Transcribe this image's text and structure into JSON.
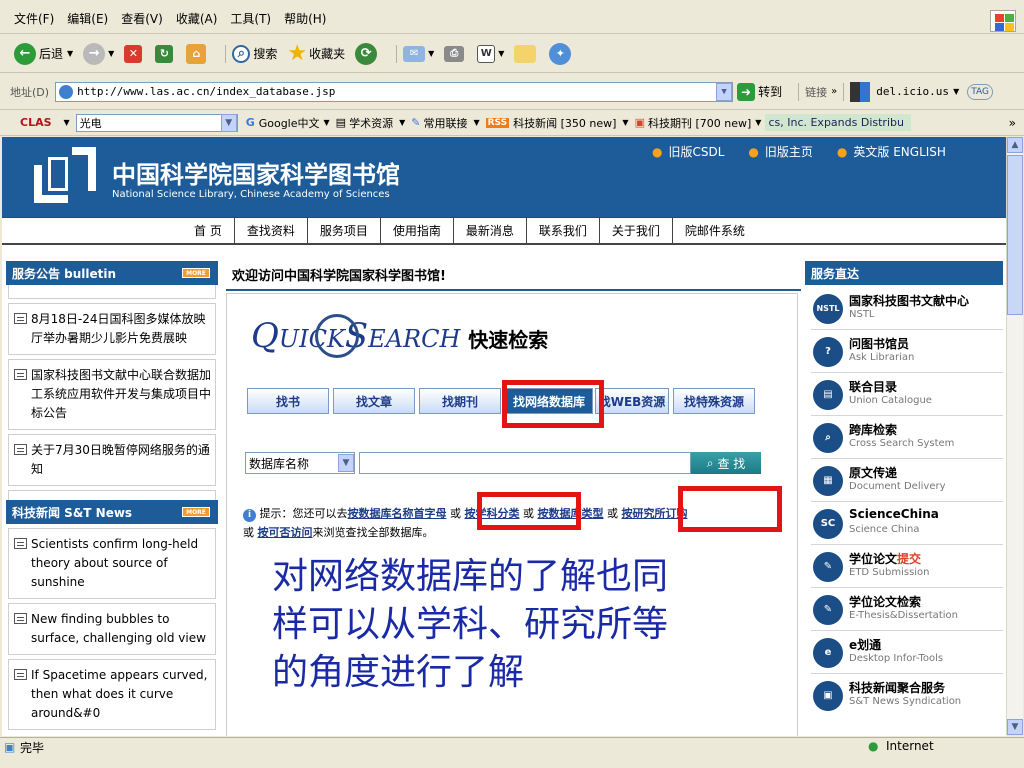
{
  "menu": {
    "items": [
      "文件(F)",
      "编辑(E)",
      "查看(V)",
      "收藏(A)",
      "工具(T)",
      "帮助(H)"
    ]
  },
  "toolbar": {
    "back": "后退",
    "search": "搜索",
    "favorites": "收藏夹"
  },
  "address": {
    "label": "地址(D)",
    "url": "http://www.las.ac.cn/index_database.jsp",
    "go": "转到",
    "links": "链接",
    "delicious": "del.icio.us",
    "tag": "TAG"
  },
  "linkbar": {
    "clas": "CLAS",
    "field": "光电",
    "items": [
      "Google中文",
      "学术资源",
      "常用联接",
      "科技新闻 [350 new]",
      "科技期刊 [700 new]"
    ],
    "rss": "RSS",
    "ticker": "cs, Inc. Expands Distribu"
  },
  "site": {
    "title_cn": "中国科学院国家科学图书馆",
    "title_en": "National Science Library, Chinese Academy of Sciences",
    "toplinks": [
      "旧版CSDL",
      "旧版主页",
      "英文版 ENGLISH"
    ],
    "nav": [
      "首 页",
      "查找资料",
      "服务项目",
      "使用指南",
      "最新消息",
      "联系我们",
      "关于我们",
      "院邮件系统"
    ]
  },
  "bulletin": {
    "heading": "服务公告 bulletin",
    "more": "MORE",
    "items": [
      "8月18日-24日国科图多媒体放映厅举办暑期少儿影片免费展映",
      "国家科技图书文献中心联合数据加工系统应用软件开发与集成项目中标公告",
      "关于7月30日晚暂停网络服务的通知"
    ]
  },
  "news": {
    "heading": "科技新闻 S&T News",
    "more": "MORE",
    "items": [
      "Scientists confirm long-held theory about source of sunshine",
      "New finding bubbles to surface, challenging old view",
      "If Spacetime appears curved, then what does it curve around&#0"
    ]
  },
  "main": {
    "welcome": "欢迎访问中国科学院国家科学图书馆!",
    "quick_a": "Q",
    "quick_b": "UICK",
    "quick_c": "S",
    "quick_d": "EARCH",
    "quick_cn": "快速检索",
    "tabs": [
      "找书",
      "找文章",
      "找期刊",
      "找网络数据库",
      "找WEB资源",
      "找特殊资源"
    ],
    "select_value": "数据库名称",
    "search_btn": "查 找",
    "hint_prefix": "提示：您还可以去",
    "hint_link1": "按数据库名称首字母",
    "or1": "或",
    "hint_link2": "按学科分类",
    "or2": "或",
    "hint_link3": "按数据库类型",
    "or3": "或",
    "hint_link4": "按研究所订购",
    "or4": "或",
    "hint_link5": "按可否访问",
    "hint_suffix": "来浏览查找全部数据库。",
    "annotation": [
      "对网络数据库的了解也同",
      "样可以从学科、研究所等",
      "的角度进行了解"
    ]
  },
  "services": {
    "heading": "服务直达",
    "items": [
      {
        "title": "国家科技图书文献中心",
        "sub": "NSTL",
        "icon": "NSTL"
      },
      {
        "title": "问图书馆员",
        "sub": "Ask Librarian",
        "icon": "ask-icon"
      },
      {
        "title": "联合目录",
        "sub": "Union Catalogue",
        "icon": "catalog-icon"
      },
      {
        "title": "跨库检索",
        "sub": "Cross Search System",
        "icon": "search-icon"
      },
      {
        "title": "原文传递",
        "sub": "Document Delivery",
        "icon": "doc-icon"
      },
      {
        "title": "ScienceChina",
        "sub": "Science China",
        "icon": "SC"
      },
      {
        "title": "学位论文",
        "title_b": "提交",
        "sub": "ETD Submission",
        "icon": "etd-icon"
      },
      {
        "title": "学位论文检索",
        "sub": "E-Thesis&Dissertation",
        "icon": "thesis-icon"
      },
      {
        "title": "e划通",
        "sub": "Desktop Infor-Tools",
        "icon": "e-icon"
      },
      {
        "title": "科技新闻聚合服务",
        "sub": "S&T News Syndication",
        "icon": "news-icon"
      }
    ]
  },
  "status": {
    "left": "完毕",
    "right": "Internet"
  },
  "colors": {
    "banner": "#1d5c98",
    "red": "#e21414",
    "link": "#1d3b8a",
    "annotation": "#1a2aa6"
  }
}
